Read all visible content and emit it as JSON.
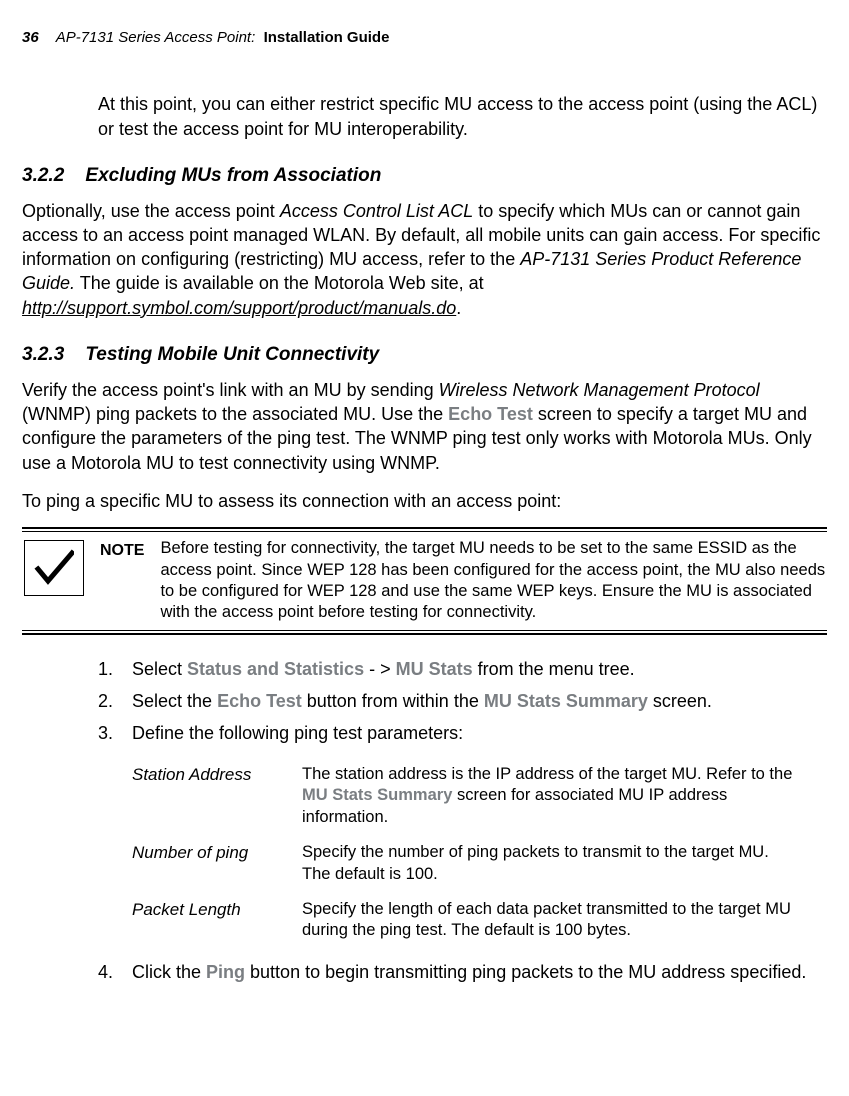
{
  "header": {
    "page_number": "36",
    "series": "AP-7131 Series Access Point:",
    "doc_title": "Installation Guide"
  },
  "intro_paragraph": "At this point, you can either restrict specific MU access to the access point (using the ACL) or test the access point for MU interoperability.",
  "section_322": {
    "number": "3.2.2",
    "title": "Excluding MUs from Association",
    "p_part1": "Optionally, use the access point ",
    "p_acl": "Access Control List ACL",
    "p_part2": " to specify which MUs can or cannot gain access to an access point managed WLAN. By default, all mobile units can gain access. For specific information on configuring (restricting) MU access, refer to the ",
    "p_prg": "AP-7131 Series Product Reference Guide.",
    "p_part3": " The guide is available on the Motorola Web site, at ",
    "p_link": "http://support.symbol.com/support/product/manuals.do",
    "p_part4": "."
  },
  "section_323": {
    "number": "3.2.3",
    "title": "Testing Mobile Unit Connectivity",
    "p1_part1": "Verify the access point's link with an MU by sending ",
    "p1_wnmp": "Wireless Network Management Protocol",
    "p1_part2": " (WNMP) ping packets to the associated MU. Use the ",
    "p1_echo": "Echo Test",
    "p1_part3": " screen to specify a target MU and configure the parameters of the ping test. The WNMP ping test only works with Motorola MUs. Only use a Motorola MU to test connectivity using WNMP.",
    "p2": "To ping a specific MU to assess its connection with an access point:"
  },
  "note": {
    "label": "NOTE",
    "text": "Before testing for connectivity, the target MU needs to be set to the same ESSID as the access point. Since WEP 128 has been configured for the access point, the MU also needs to be configured for WEP 128 and use the same WEP keys. Ensure the MU is associated with the access point before testing for connectivity."
  },
  "steps": {
    "s1_num": "1.",
    "s1_a": "Select ",
    "s1_b": "Status and Statistics",
    "s1_c": " - > ",
    "s1_d": "MU Stats",
    "s1_e": " from the menu tree.",
    "s2_num": "2.",
    "s2_a": "Select the ",
    "s2_b": "Echo Test",
    "s2_c": " button from within the ",
    "s2_d": "MU Stats Summary",
    "s2_e": " screen.",
    "s3_num": "3.",
    "s3_a": "Define the following ping test parameters:",
    "s4_num": "4.",
    "s4_a": "Click the ",
    "s4_b": "Ping",
    "s4_c": " button to begin transmitting ping packets to the MU address specified."
  },
  "params": {
    "r1_name": "Station Address",
    "r1_a": "The station address is the IP address of the target MU. Refer to the ",
    "r1_b": "MU Stats Summary",
    "r1_c": " screen for associated MU IP address information.",
    "r2_name": "Number of ping",
    "r2_desc": "Specify the number of ping packets to transmit to the target MU. The default is 100.",
    "r3_name": "Packet Length",
    "r3_desc": "Specify the length of each data packet transmitted to the target MU during the ping test. The default is 100 bytes."
  }
}
